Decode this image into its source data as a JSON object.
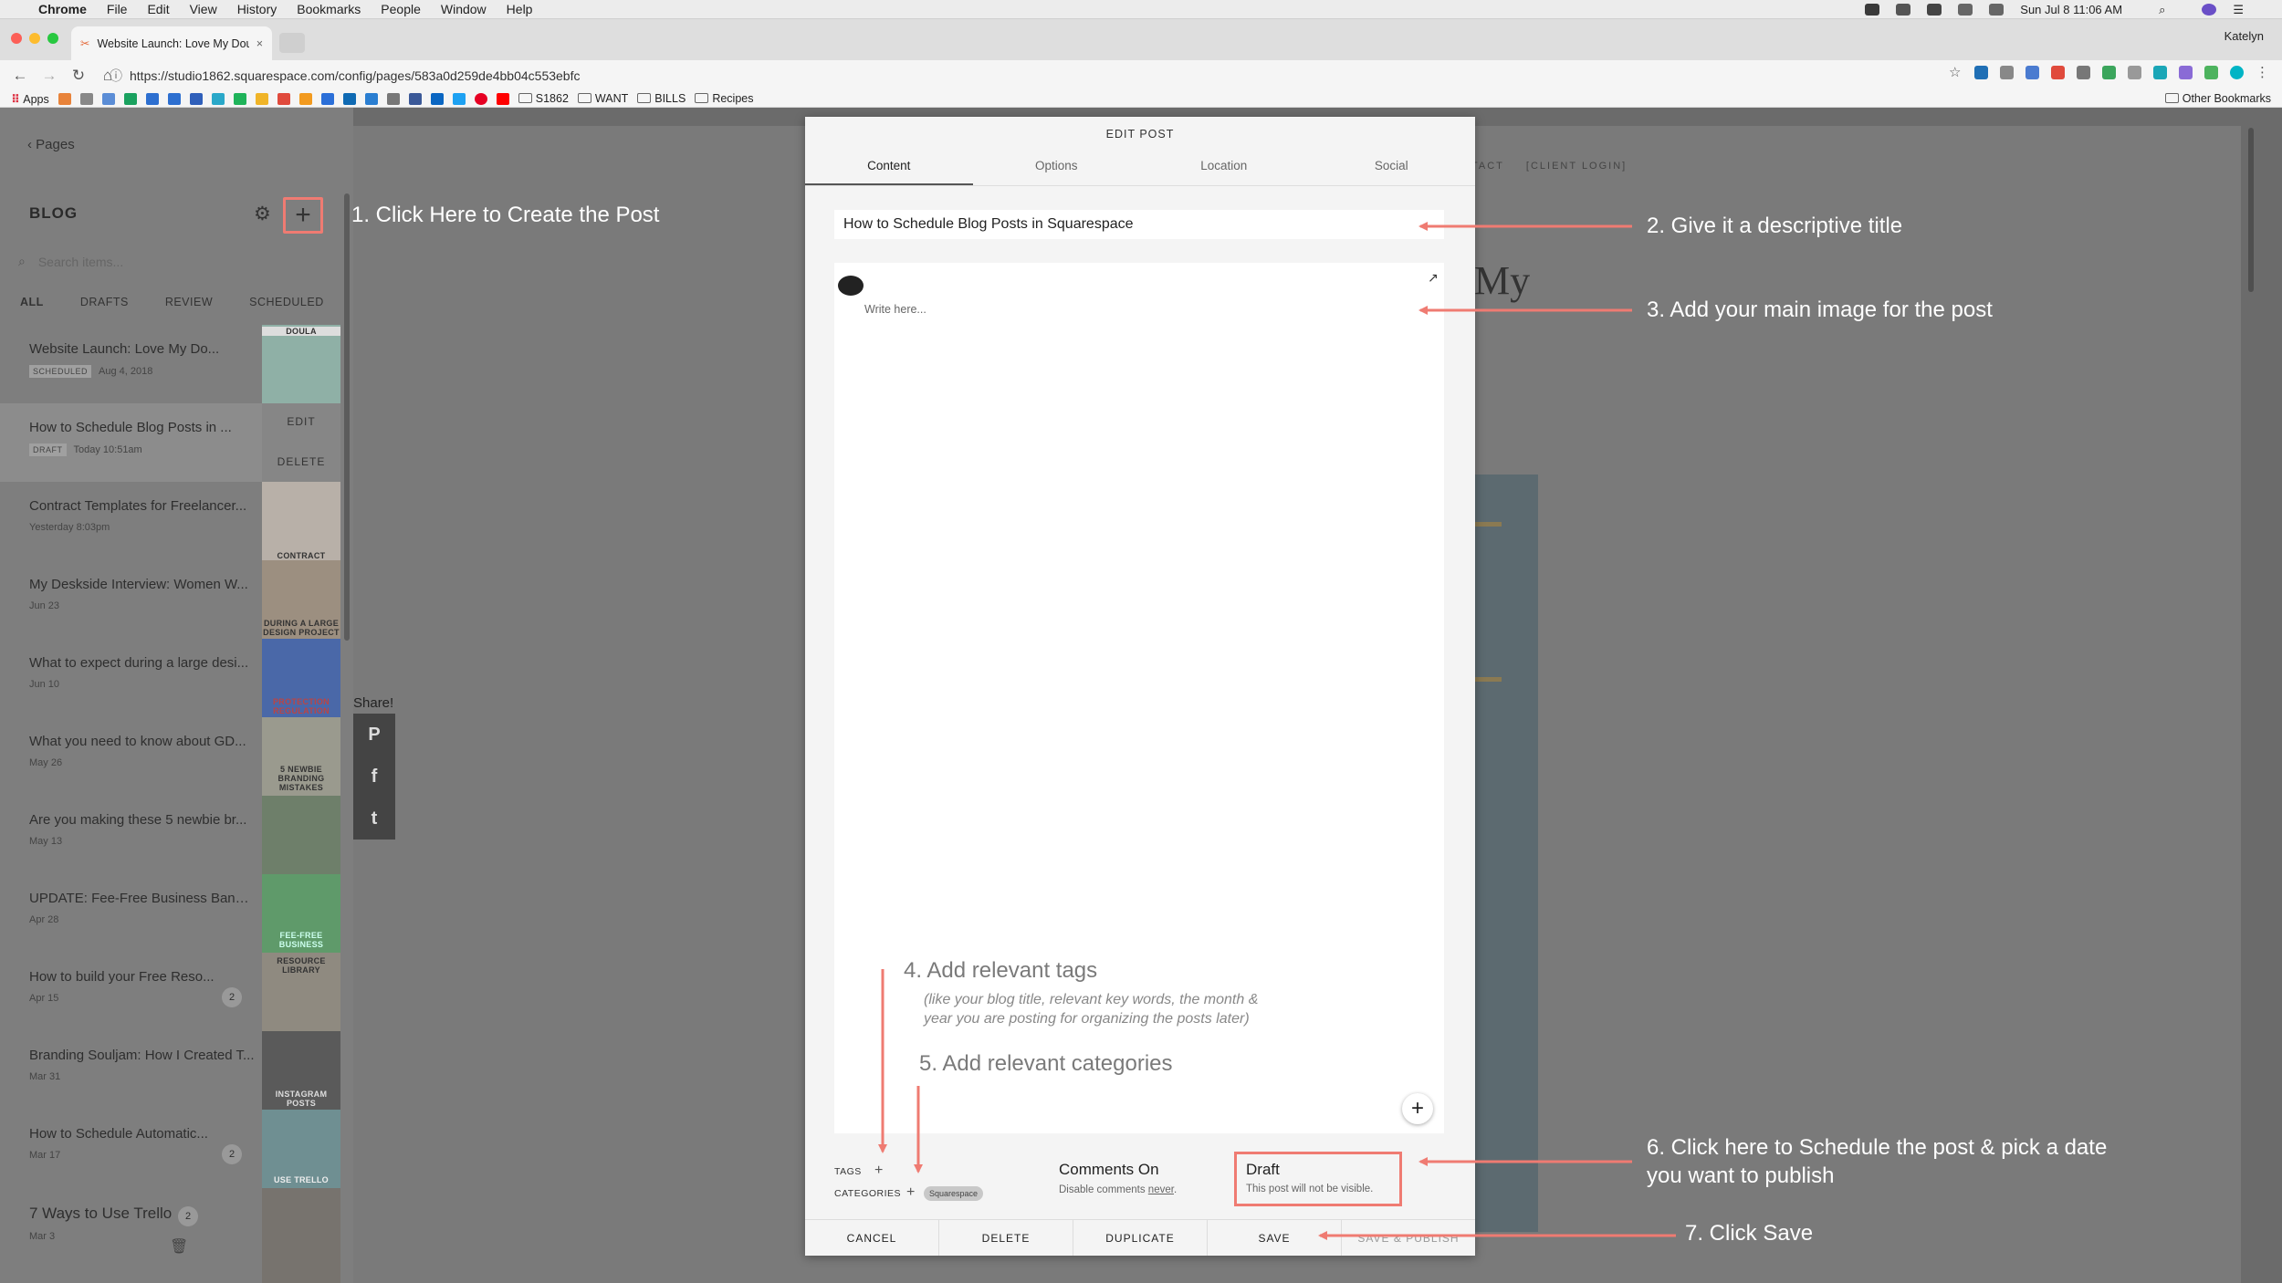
{
  "menubar": {
    "app": "Chrome",
    "items": [
      "File",
      "Edit",
      "View",
      "History",
      "Bookmarks",
      "People",
      "Window",
      "Help"
    ],
    "clock": "Sun Jul 8  11:06 AM"
  },
  "browser": {
    "tab_title": "Website Launch: Love My Dou",
    "profile": "Katelyn",
    "url": "https://studio1862.squarespace.com/config/pages/583a0d259de4bb04c553ebfc",
    "bookmarks": [
      "Apps",
      "S1862",
      "WANT",
      "BILLS",
      "Recipes"
    ],
    "other_bookmarks": "Other Bookmarks"
  },
  "sidebar": {
    "back_label": "Pages",
    "title": "BLOG",
    "search_placeholder": "Search items...",
    "filters": [
      "ALL",
      "DRAFTS",
      "REVIEW",
      "SCHEDULED"
    ],
    "row_actions": [
      "EDIT",
      "DELETE"
    ],
    "posts": [
      {
        "title": "Website Launch: Love My Do...",
        "badge": "SCHEDULED",
        "date": "Aug 4, 2018",
        "thumb_text": "DOULA"
      },
      {
        "title": "How to Schedule Blog Posts in ...",
        "badge": "DRAFT",
        "date": "Today 10:51am",
        "thumb_text": ""
      },
      {
        "title": "Contract Templates for Freelancer...",
        "badge": "",
        "date": "Yesterday 8:03pm",
        "thumb_text": "CONTRACT"
      },
      {
        "title": "My Deskside Interview: Women W...",
        "badge": "",
        "date": "Jun 23",
        "thumb_text": "DURING A LARGE DESIGN PROJECT"
      },
      {
        "title": "What to expect during a large desi...",
        "badge": "",
        "date": "Jun 10",
        "thumb_text": "PROTECTION REGULATION"
      },
      {
        "title": "What you need to know about GD...",
        "badge": "",
        "date": "May 26",
        "thumb_text": "5 NEWBIE BRANDING MISTAKES"
      },
      {
        "title": "Are you making these 5 newbie br...",
        "badge": "",
        "date": "May 13",
        "thumb_text": ""
      },
      {
        "title": "UPDATE: Fee-Free Business Banki...",
        "badge": "",
        "date": "Apr 28",
        "thumb_text": "FEE-FREE BUSINESS"
      },
      {
        "title": "How to build your Free Reso...",
        "badge": "",
        "date": "Apr 15",
        "count": "2",
        "thumb_text": "RESOURCE LIBRARY"
      },
      {
        "title": "Branding Souljam: How I Created T...",
        "badge": "",
        "date": "Mar 31",
        "thumb_text": "INSTAGRAM POSTS"
      },
      {
        "title": "How to Schedule Automatic...",
        "badge": "",
        "date": "Mar 17",
        "count": "2",
        "thumb_text": "USE TRELLO"
      },
      {
        "title": "7 Ways to Use Trello",
        "badge": "",
        "date": "Mar 3",
        "count": "2",
        "thumb_text": ""
      }
    ]
  },
  "share": {
    "label": "Share!"
  },
  "site": {
    "nav": [
      "TACT",
      "[CLIENT LOGIN]"
    ],
    "heading": "My"
  },
  "modal": {
    "header": "EDIT POST",
    "tabs": [
      "Content",
      "Options",
      "Location",
      "Social"
    ],
    "title_value": "How to Schedule Blog Posts in Squarespace",
    "body_placeholder": "Write here...",
    "tags_label": "TAGS",
    "categories_label": "CATEGORIES",
    "category_chip": "Squarespace",
    "comments_title": "Comments On",
    "comments_sub_prefix": "Disable comments ",
    "comments_sub_link": "never",
    "comments_sub_suffix": ".",
    "status_title": "Draft",
    "status_sub": "This post will not be visible.",
    "actions": [
      "CANCEL",
      "DELETE",
      "DUPLICATE",
      "SAVE",
      "SAVE & PUBLISH"
    ]
  },
  "annotations": {
    "step1": "1. Click Here to Create the Post",
    "step2": "2. Give it a descriptive title",
    "step3": "3. Add your main image for the post",
    "step4": "4. Add relevant tags",
    "step4_note_1": "(like your blog title, relevant key words, the month &",
    "step4_note_2": "year you are posting for organizing the posts later)",
    "step5": "5. Add relevant categories",
    "step6_line1": "6. Click here to Schedule the post & pick a date",
    "step6_line2": "you want to publish",
    "step7": "7. Click Save",
    "arrow_color": "#ef7b72"
  }
}
